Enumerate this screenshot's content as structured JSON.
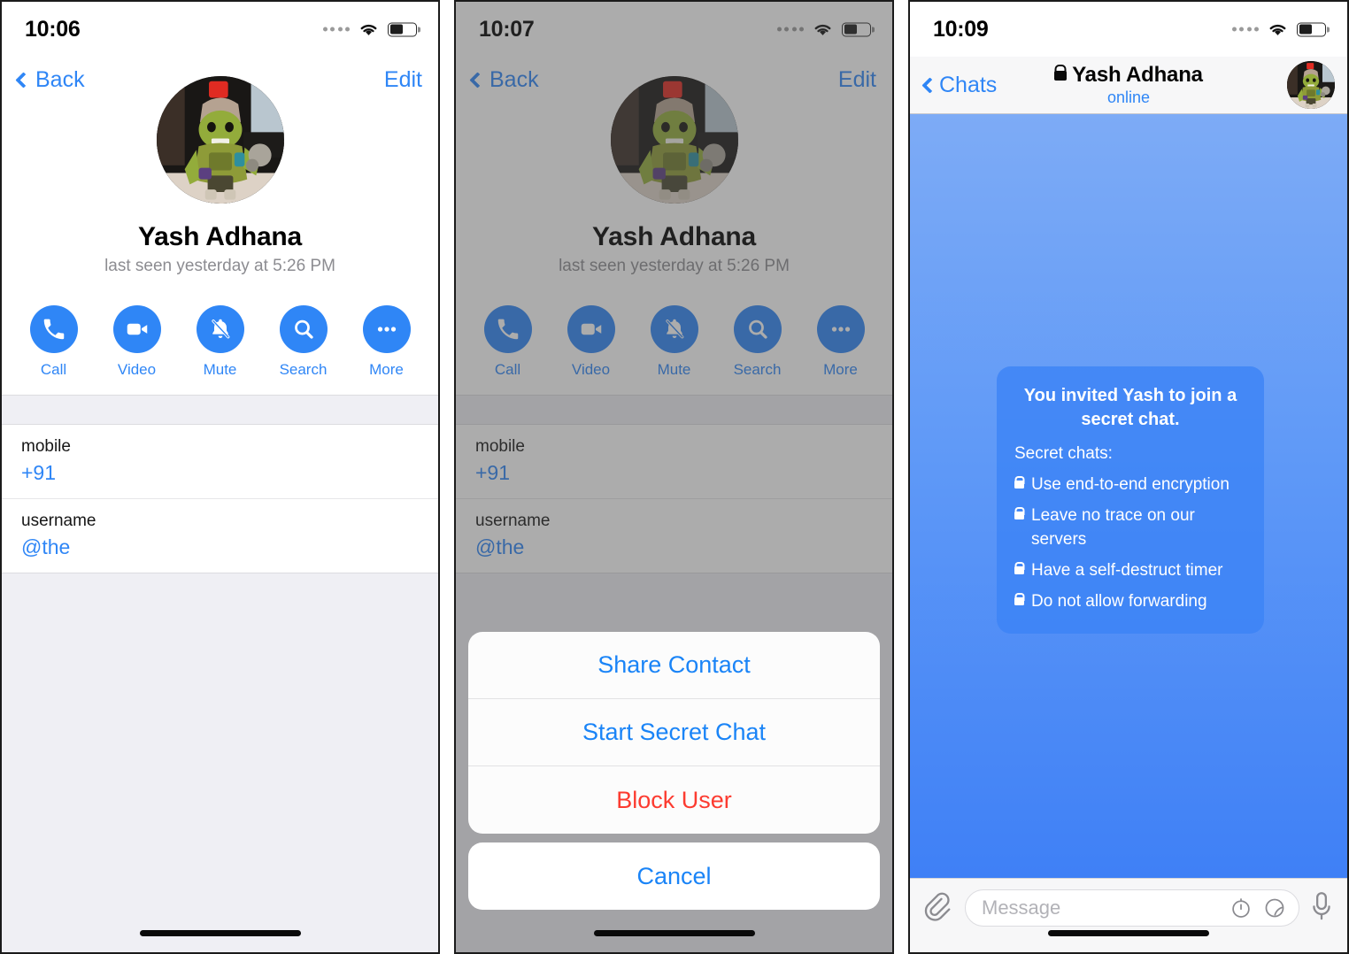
{
  "panels": [
    {
      "id": "profile",
      "status": {
        "time": "10:06",
        "signal_icon": "signal-dots-icon",
        "wifi_icon": "wifi-icon",
        "battery_icon": "battery-icon"
      },
      "nav": {
        "back_label": "Back",
        "edit_label": "Edit"
      },
      "profile": {
        "avatar_icon": "contact-avatar",
        "name": "Yash Adhana",
        "subtitle": "last seen yesterday at 5:26 PM"
      },
      "actions": [
        {
          "label": "Call",
          "icon": "phone-icon"
        },
        {
          "label": "Video",
          "icon": "video-camera-icon"
        },
        {
          "label": "Mute",
          "icon": "bell-slash-icon"
        },
        {
          "label": "Search",
          "icon": "search-icon"
        },
        {
          "label": "More",
          "icon": "ellipsis-icon"
        }
      ],
      "info_rows": [
        {
          "key": "mobile",
          "value": "+91"
        },
        {
          "key": "username",
          "value": "@the"
        }
      ]
    },
    {
      "id": "action-sheet",
      "status": {
        "time": "10:07"
      },
      "nav": {
        "back_label": "Back",
        "edit_label": "Edit"
      },
      "profile": {
        "avatar_icon": "contact-avatar",
        "name": "Yash Adhana",
        "subtitle": "last seen yesterday at 5:26 PM"
      },
      "actions": [
        {
          "label": "Call",
          "icon": "phone-icon"
        },
        {
          "label": "Video",
          "icon": "video-camera-icon"
        },
        {
          "label": "Mute",
          "icon": "bell-slash-icon"
        },
        {
          "label": "Search",
          "icon": "search-icon"
        },
        {
          "label": "More",
          "icon": "ellipsis-icon"
        }
      ],
      "info_rows": [
        {
          "key": "mobile",
          "value": "+91"
        },
        {
          "key": "username",
          "value": "@the"
        }
      ],
      "sheet": {
        "items": [
          {
            "label": "Share Contact",
            "style": "default"
          },
          {
            "label": "Start Secret Chat",
            "style": "default"
          },
          {
            "label": "Block User",
            "style": "destructive"
          }
        ],
        "cancel_label": "Cancel"
      }
    },
    {
      "id": "secret-chat",
      "status": {
        "time": "10:09"
      },
      "nav": {
        "back_label": "Chats",
        "title": "Yash Adhana",
        "lock_icon": "lock-icon",
        "status": "online",
        "avatar_icon": "contact-avatar"
      },
      "message": {
        "title": "You invited Yash to join a secret chat.",
        "subtitle": "Secret chats:",
        "bullets": [
          "Use end-to-end encryption",
          "Leave no trace on our servers",
          "Have a self-destruct timer",
          "Do not allow forwarding"
        ]
      },
      "composer": {
        "attach_icon": "paperclip-icon",
        "placeholder": "Message",
        "timer_icon": "self-destruct-timer-icon",
        "sticker_icon": "sticker-icon",
        "mic_icon": "microphone-icon"
      }
    }
  ],
  "colors": {
    "accent": "#2f86f6",
    "destructive": "#fc3b30",
    "chat_bg_top": "#7dabf6",
    "chat_bg_bottom": "#3f80f6",
    "bubble": "#3b83f6",
    "list_bg": "#efeff4"
  }
}
